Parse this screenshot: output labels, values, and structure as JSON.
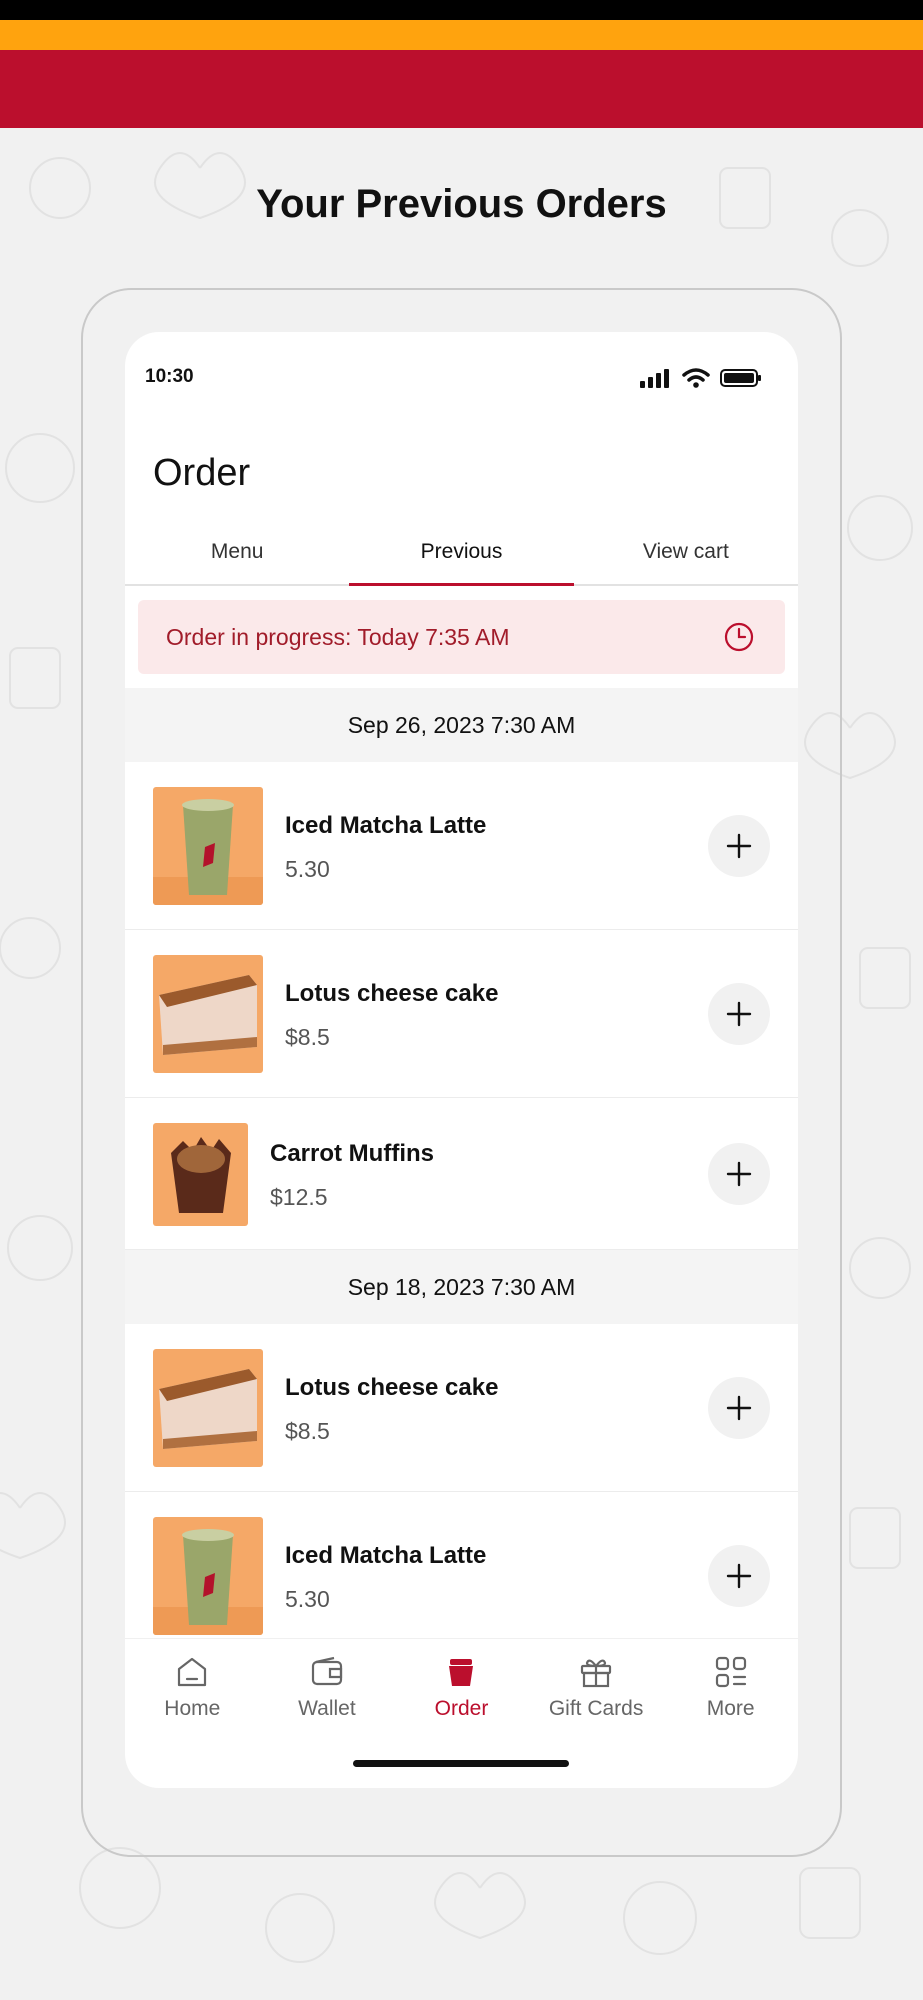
{
  "promo": {
    "headline": "Your Previous Orders"
  },
  "status_bar": {
    "time": "10:30",
    "icons": [
      "signal-icon",
      "wifi-icon",
      "battery-icon"
    ]
  },
  "screen": {
    "title": "Order"
  },
  "tabs": [
    {
      "label": "Menu",
      "active": false
    },
    {
      "label": "Previous",
      "active": true
    },
    {
      "label": "View cart",
      "active": false
    }
  ],
  "progress_banner": {
    "text": "Order in progress: Today 7:35 AM",
    "icon": "clock-icon"
  },
  "order_groups": [
    {
      "date": "Sep 26, 2023  7:30 AM",
      "items": [
        {
          "name": "Iced Matcha Latte",
          "price": "5.30",
          "image": "iced-matcha-latte-image"
        },
        {
          "name": "Lotus cheese cake",
          "price": "$8.5",
          "image": "lotus-cheese-cake-image"
        },
        {
          "name": "Carrot Muffins",
          "price": "$12.5",
          "image": "carrot-muffins-image"
        }
      ]
    },
    {
      "date": "Sep 18, 2023  7:30 AM",
      "items": [
        {
          "name": "Lotus cheese cake",
          "price": "$8.5",
          "image": "lotus-cheese-cake-image"
        },
        {
          "name": "Iced Matcha Latte",
          "price": "5.30",
          "image": "iced-matcha-latte-image"
        }
      ]
    }
  ],
  "bottom_nav": [
    {
      "label": "Home",
      "icon": "home-icon",
      "active": false
    },
    {
      "label": "Wallet",
      "icon": "wallet-icon",
      "active": false
    },
    {
      "label": "Order",
      "icon": "cup-icon",
      "active": true
    },
    {
      "label": "Gift Cards",
      "icon": "gift-icon",
      "active": false
    },
    {
      "label": "More",
      "icon": "grid-icon",
      "active": false
    }
  ],
  "colors": {
    "brand_red": "#BB0F2D",
    "brand_orange": "#FFA30E",
    "banner_bg": "#FBE9EA",
    "banner_text": "#A11C2A"
  }
}
